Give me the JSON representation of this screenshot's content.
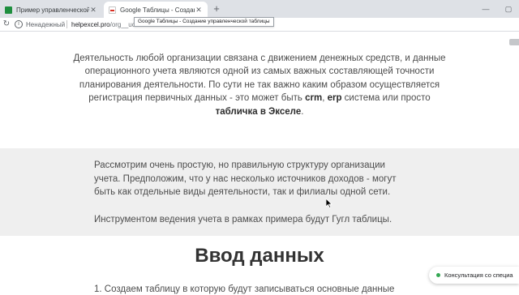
{
  "browser": {
    "tabs": [
      {
        "title": "Пример управленческой таб",
        "active": false,
        "icon": "sheets-icon"
      },
      {
        "title": "Google Таблицы - Создание у",
        "active": true,
        "icon": "google-doc-icon"
      }
    ],
    "new_tab_label": "+",
    "tooltip": "Google Таблицы - Создание управленческой таблицы",
    "security_label": "Ненадежный",
    "url_domain": "helpexcel.pro",
    "url_path": "/org__uch"
  },
  "page": {
    "intro": {
      "part1": "Деятельность любой организации связана с движением денежных средств, и данные операционного учета являются одной из самых важных составляющей точности планирования деятельности. По сути не так важно каким образом осуществляется регистрация первичных данных - это может быть ",
      "crm": "crm",
      "comma": ", ",
      "erp": "erp",
      "part2": " система или просто ",
      "bold_tail": "табличка в Экселе",
      "period": "."
    },
    "grey_block": {
      "p1": "Рассмотрим очень простую, но правильную структуру организации учета. Предположим, что у нас несколько источников доходов - могут быть как отдельные виды деятельности, так и филиалы одной сети.",
      "p2": "Инструментом ведения учета в рамках примера будут Гугл таблицы."
    },
    "section_heading": "Ввод данных",
    "list_item_1": "1. Создаем таблицу в которую будут записываться основные данные"
  },
  "widget": {
    "consult_label": "Консультация со специа",
    "status_color": "#34a853"
  }
}
